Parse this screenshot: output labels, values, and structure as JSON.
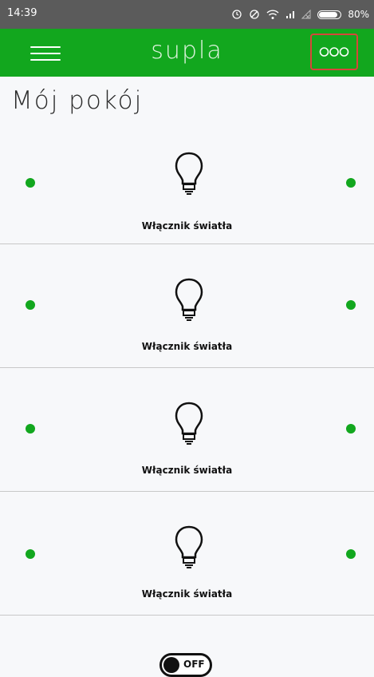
{
  "status_bar": {
    "time": "14:39",
    "battery": "80%",
    "icons": [
      "alarm-icon",
      "do-not-disturb-icon",
      "wifi-icon",
      "signal-icon",
      "no-signal-icon",
      "battery-icon"
    ]
  },
  "app_bar": {
    "title": "supla",
    "menu_icon": "hamburger-menu-icon",
    "more_icon": "three-circles-icon",
    "color": "#12a71e",
    "highlight_color": "#d7463a"
  },
  "location": {
    "title": "Mój pokój"
  },
  "channels": [
    {
      "label": "Włącznik światła",
      "icon": "light-bulb-icon",
      "status_color": "#12a71e"
    },
    {
      "label": "Włącznik światła",
      "icon": "light-bulb-icon",
      "status_color": "#12a71e"
    },
    {
      "label": "Włącznik światła",
      "icon": "light-bulb-icon",
      "status_color": "#12a71e"
    },
    {
      "label": "Włącznik światła",
      "icon": "light-bulb-icon",
      "status_color": "#12a71e"
    }
  ],
  "partial_channel": {
    "icon": "toggle-switch-icon",
    "state": "OFF"
  }
}
